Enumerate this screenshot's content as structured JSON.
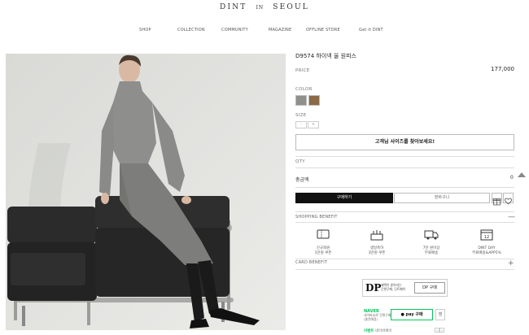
{
  "brand": {
    "part1": "DINT",
    "part2": "IN",
    "part3": "SEOUL"
  },
  "nav": [
    "SHOP",
    "COLLECTION",
    "COMMUNITY",
    "MAGAZINE",
    "OFFLINE STORE",
    "Get it DINT"
  ],
  "product": {
    "title": "D9574 하이넥 울 원피스",
    "price_label": "PRICE",
    "price": "177,000",
    "color_label": "COLOR",
    "colors": [
      "#8f8f8b",
      "#8a6a47"
    ],
    "size_label": "SIZE",
    "sizes": [
      "-",
      "+"
    ],
    "size_finder": "고객님 사이즈를 찾아보세요!",
    "qty_label": "QTY",
    "total_label": "총금액",
    "total_value": "0",
    "buy_label": "구매하기",
    "cart_label": "장바구니"
  },
  "shopping_benefit": {
    "title": "SHOPPING BENEFIT",
    "toggle": "—",
    "items": [
      {
        "icon": "coupon-icon",
        "line1": "신규회원",
        "line2": "1만원 쿠폰"
      },
      {
        "icon": "birthday-cake-icon",
        "line1": "생일축하",
        "line2": "3만원 쿠폰"
      },
      {
        "icon": "delivery-truck-icon",
        "line1": "7만 원이상",
        "line2": "무료배송"
      },
      {
        "icon": "calendar-icon",
        "line1": "DINT DAY",
        "line2": "무료배송&APP5%"
      }
    ]
  },
  "card_benefit": {
    "title": "CARD BENEFIT",
    "toggle": "+"
  },
  "dp": {
    "logo": "DP",
    "text1": "혜택이 쏟아지는",
    "text2": "간편구매, 딘트페이",
    "button": "DP 구매"
  },
  "naver": {
    "logo": "NAVER",
    "sub1": "네이버ID로 간편구매",
    "sub2": "(충전예정)",
    "pay_button": "● pay 구매",
    "side_button": "찜",
    "event_label": "이벤트",
    "event_text": "네이버페이"
  }
}
